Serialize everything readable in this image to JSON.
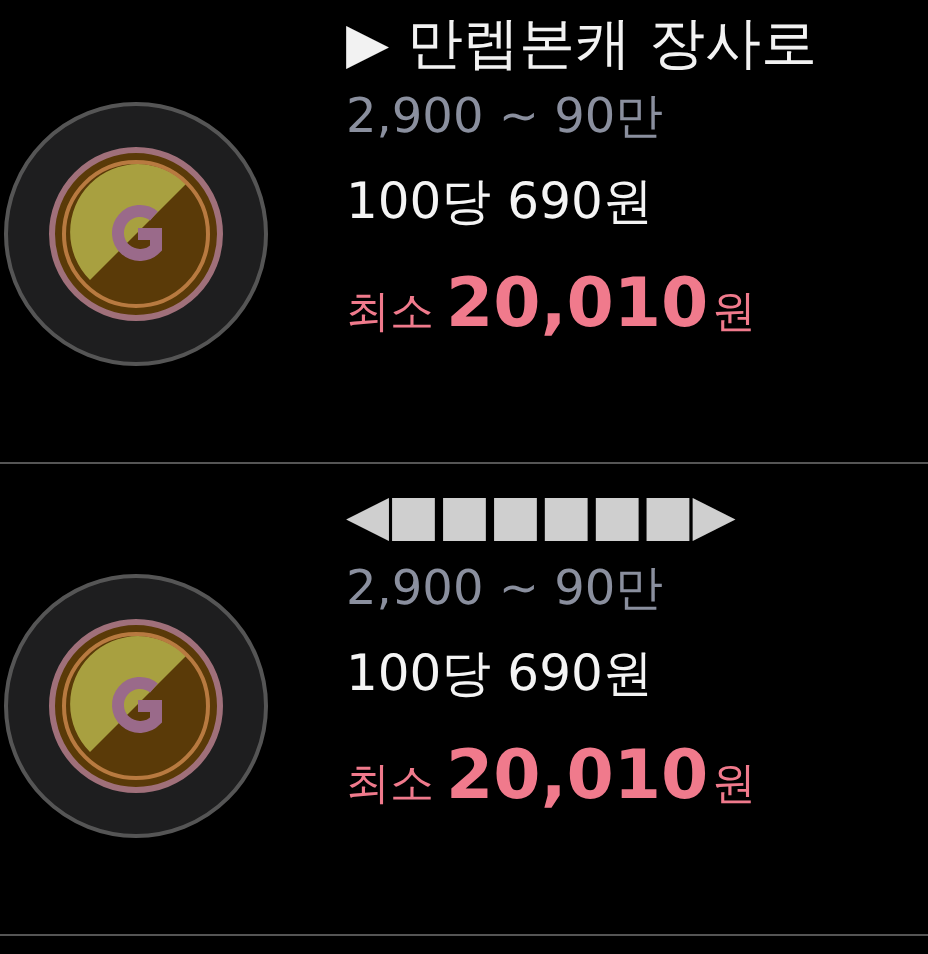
{
  "items": [
    {
      "title": "▶ 만렙본캐 장사로",
      "range": "2,900 ~ 90만",
      "unit_price": "100당 690원",
      "min_label": "최소",
      "min_amount": "20,010",
      "min_unit": "원"
    },
    {
      "title": "◀■■■■■■▶",
      "range": "2,900 ~ 90만",
      "unit_price": "100당 690원",
      "min_label": "최소",
      "min_amount": "20,010",
      "min_unit": "원"
    }
  ]
}
